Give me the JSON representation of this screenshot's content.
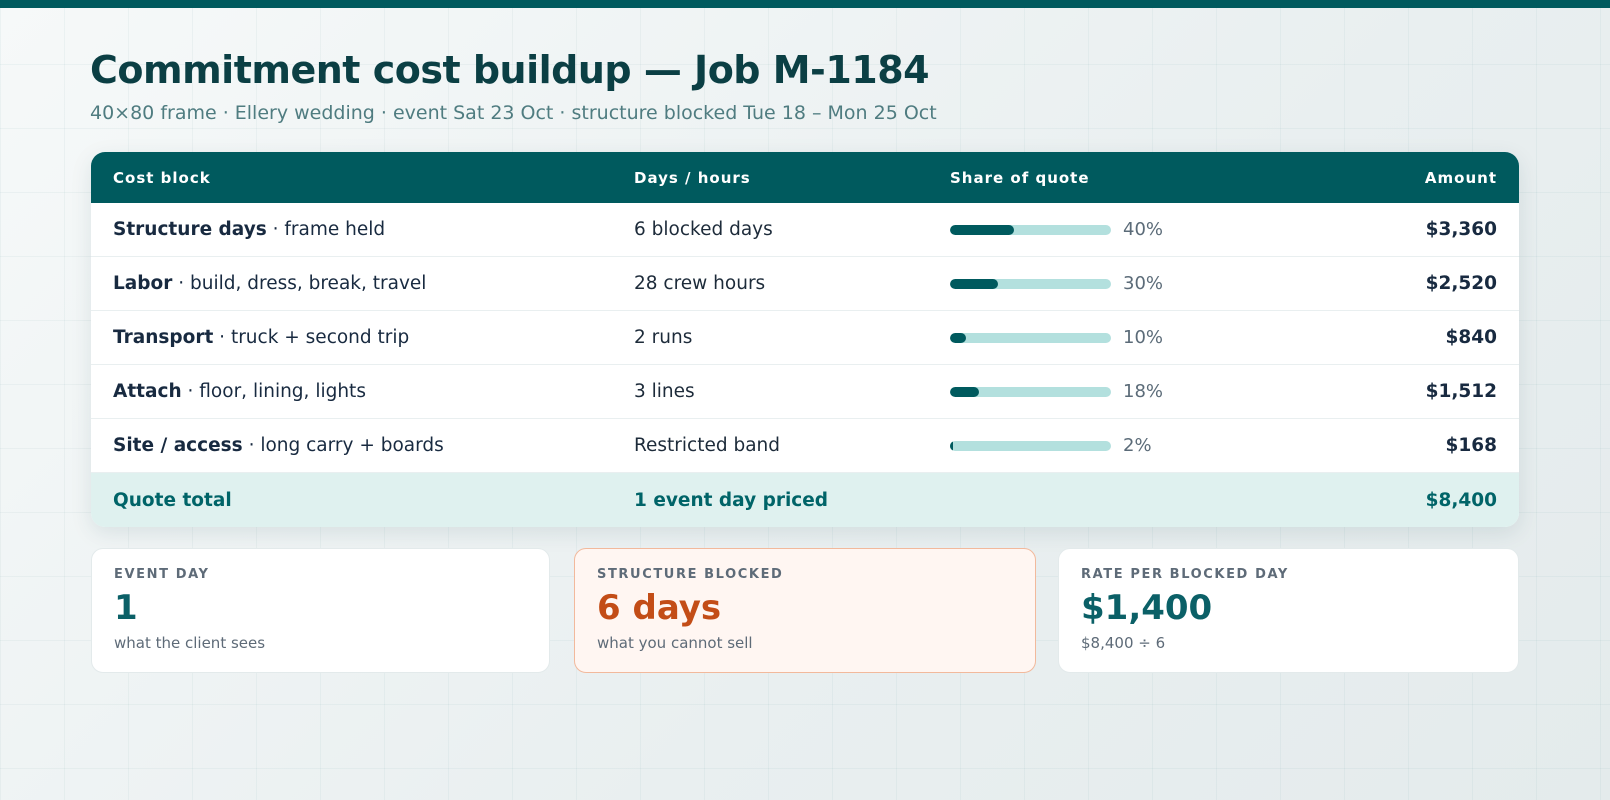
{
  "header": {
    "title": "Commitment cost buildup — Job M-1184",
    "subtitle": "40×80 frame · Ellery wedding · event Sat 23 Oct · structure blocked Tue 18 – Mon 25 Oct"
  },
  "table": {
    "columns": [
      "Cost block",
      "Days / hours",
      "Share of quote",
      "Amount"
    ],
    "rows": [
      {
        "name": "Structure days",
        "desc": " · frame held",
        "qty": "6 blocked days",
        "share": 40,
        "share_label": "40%",
        "amount": "$3,360"
      },
      {
        "name": "Labor",
        "desc": " · build, dress, break, travel",
        "qty": "28 crew hours",
        "share": 30,
        "share_label": "30%",
        "amount": "$2,520"
      },
      {
        "name": "Transport",
        "desc": " · truck + second trip",
        "qty": "2 runs",
        "share": 10,
        "share_label": "10%",
        "amount": "$840"
      },
      {
        "name": "Attach",
        "desc": " · floor, lining, lights",
        "qty": "3 lines",
        "share": 18,
        "share_label": "18%",
        "amount": "$1,512"
      },
      {
        "name": "Site / access",
        "desc": " · long carry + boards",
        "qty": "Restricted band",
        "share": 2,
        "share_label": "2%",
        "amount": "$168"
      }
    ],
    "total": {
      "label": "Quote total",
      "qty": "1 event day priced",
      "amount": "$8,400"
    }
  },
  "stats": [
    {
      "label": "EVENT DAY",
      "value": "1",
      "note": "what the client sees"
    },
    {
      "label": "STRUCTURE BLOCKED",
      "value": "6 days",
      "note": "what you cannot sell"
    },
    {
      "label": "RATE PER BLOCKED DAY",
      "value": "$1,400",
      "note": "$8,400 ÷ 6"
    }
  ],
  "colors": {
    "accent": "#005a5e",
    "bar_track": "#b3e0de",
    "warning": "#c34d17",
    "total_bg": "#dff1ef"
  }
}
